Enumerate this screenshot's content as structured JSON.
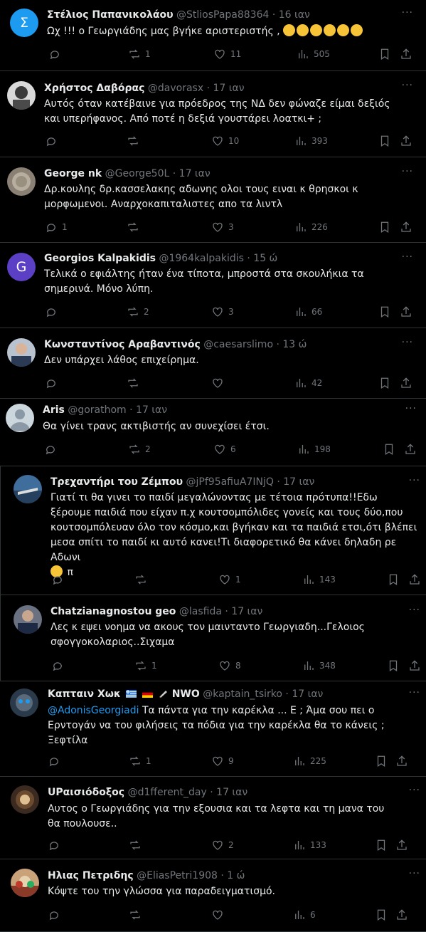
{
  "tweets": [
    {
      "name": "Στέλιος Παπανικολάου",
      "handle": "@StliosPapa88364",
      "time": "16 ιαν",
      "text": "Ωχ !!! ο Γεωργιάδης μας βγήκε αριστεριστής ,",
      "avatar_letter": "Σ",
      "avatar_color": "#1d9bf0",
      "reply": "",
      "retweet": "1",
      "like": "11",
      "views": "505",
      "emoji_count": 6
    },
    {
      "name": "Χρήστος Δαβόρας",
      "handle": "@davorasx",
      "time": "17 ιαν",
      "text": "Αυτός όταν κατέβαινε για πρόεδρος της ΝΔ δεν φώναζε είμαι δεξιός και υπερήφανος. Από ποτέ η δεξιά γουστάρει λοατκι+ ;",
      "avatar_color": "#d9d9d9",
      "reply": "",
      "retweet": "",
      "like": "10",
      "views": "393"
    },
    {
      "name": "George nk",
      "handle": "@George50L",
      "time": "17 ιαν",
      "text": "Δρ.κουλης δρ.κασσελακης αδωνης ολοι τους ειναι κ θρησκοι κ μορφωμενοι. Αναρχοκαπιταλιστες απο τα λιντλ",
      "avatar_color": "#8a8174",
      "reply": "1",
      "retweet": "",
      "like": "3",
      "views": "226"
    },
    {
      "name": "Georgios Kalpakidis",
      "handle": "@1964kalpakidis",
      "time": "15 ώ",
      "text": "Τελικά ο εφιάλτης ήταν ένα τίποτα, μπροστά στα σκουλήκια τα σημερινά. Μόνο λύπη.",
      "avatar_letter": "G",
      "avatar_color": "#5b3fc4",
      "reply": "",
      "retweet": "2",
      "like": "3",
      "views": "66"
    },
    {
      "name": "Κωνσταντίνος Αραβαντινός",
      "handle": "@caesarslimo",
      "time": "13 ώ",
      "text": "Δεν υπάρχει λάθος επιχείρημα.",
      "avatar_color": "#b9c2cf",
      "reply": "",
      "retweet": "",
      "like": "",
      "views": "42"
    },
    {
      "name": "Aris",
      "handle": "@gorathom",
      "time": "17 ιαν",
      "text": "Θα γίνει τρανς ακτιβιστής αν συνεχίσει έτσι.",
      "avatar_color": "#ccd6dd",
      "reply": "",
      "retweet": "2",
      "like": "6",
      "views": "198"
    },
    {
      "name": "Τρεχαντήρι του Ζέμπου",
      "handle": "@jPf95afiuA7INjQ",
      "time": "17 ιαν",
      "text": "Γιατί τι θα γινει το παιδί μεγαλώνοντας με τέτοια πρότυπα!!Εδω ξέρουμε παιδιά που είχαν π.χ κουτσομπόλιδες γονείς και τους δύο,που κουτσομπόλευαν όλο τον κόσμο,και βγήκαν και τα παιδιά ετσι,ότι βλέπει μεσα σπίτι το παιδί κι αυτό κανει!Τι διαφορετικό θα κάνει δηλαδη ρε Αδωνι",
      "text_tail": "π",
      "avatar_color": "#3f6d9c",
      "reply": "",
      "retweet": "",
      "like": "1",
      "views": "143"
    },
    {
      "name": "Chatzianagnostou geo",
      "handle": "@lasfida",
      "time": "17 ιαν",
      "text": "Λες κ εψει νοημα να ακους τον μαινταντο Γεωργιαδη...Γελοιος σφογγοκολαριος..Σιχαμα",
      "avatar_color": "#6a7180",
      "reply": "",
      "retweet": "1",
      "like": "8",
      "views": "348"
    },
    {
      "name": "Καπταιν Χωκ",
      "name_suffix": "NWO",
      "handle": "@kaptain_tsirko",
      "time": "17 ιαν",
      "mention": "@AdonisGeorgiadi",
      "text": " Τα πάντα για την καρέκλα ... Ε ; Άμα σου πει ο Ερντογάν να του φιλήσεις τα πόδια για την καρέκλα θα το κάνεις ; Ξεφτίλα",
      "avatar_color": "#2a3a4a",
      "reply": "",
      "retweet": "1",
      "like": "9",
      "views": "225"
    },
    {
      "name": "UPαισιόδοξος",
      "handle": "@d1fferent_day",
      "time": "17 ιαν",
      "text": "Αυτος ο Γεωργιάδης για την εξουσια και τα λεφτα και τη μανα του θα πουλουσε..",
      "avatar_color": "#3b2a1f",
      "reply": "",
      "retweet": "",
      "like": "2",
      "views": "133"
    },
    {
      "name": "Ηλιας Πετριδης",
      "handle": "@EliasPetri1908",
      "time": "1 ώ",
      "text": "Κόψτε του την γλώσσα για παραδειγματισμό.",
      "avatar_color": "#c9a27a",
      "reply": "",
      "retweet": "",
      "like": "",
      "views": "6"
    }
  ],
  "more_label": "···"
}
